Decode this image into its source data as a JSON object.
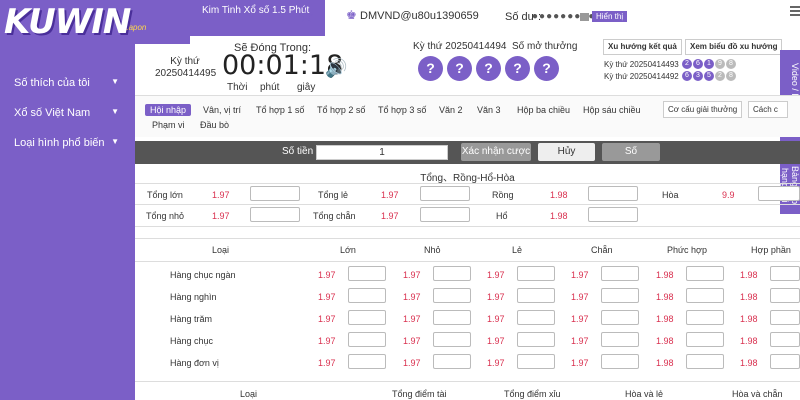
{
  "brand": {
    "logo": "KUWIN",
    "logo_sub": ".apon"
  },
  "sidebar": {
    "items": [
      {
        "label": "Số thích của tôi"
      },
      {
        "label": "Xổ số Việt Nam"
      },
      {
        "label": "Loại hình phổ biến"
      }
    ]
  },
  "header": {
    "game_title": "Kim Tinh Xổ số 1.5 Phút",
    "user": "DMVND@u80u1390659",
    "balance_label": "Số dư :",
    "balance_masked": "●●●●●●●●●●",
    "show_label": "Hiển thị"
  },
  "draw": {
    "period_label": "Kỳ thứ",
    "period": "20250414495",
    "close_label": "Sẽ Đóng Trong:",
    "timer": "00:01:18",
    "unit_h": "Thời",
    "unit_m": "phút",
    "unit_s": "giây",
    "open_period_label": "Kỳ thứ 20250414494",
    "open_label": "Số mở thưởng",
    "balls": [
      "?",
      "?",
      "?",
      "?",
      "?"
    ]
  },
  "trend": {
    "trend_btn": "Xu hướng kết quả",
    "chart_btn": "Xem biểu đồ xu hướng",
    "prev": [
      {
        "label": "Kỳ thứ 20250414493",
        "nums": [
          "2",
          "6",
          "1",
          "9",
          "8"
        ]
      },
      {
        "label": "Kỳ thứ 20250414492",
        "nums": [
          "6",
          "3",
          "5",
          "2",
          "8"
        ]
      }
    ]
  },
  "right_tabs": {
    "video": "Video / Bảng điểm",
    "table": "Bảng xếp hạng dài"
  },
  "tabs": [
    {
      "label": "Hội nhập"
    },
    {
      "label": "Vân, vị trí"
    },
    {
      "label": "Tổ hợp 1 số"
    },
    {
      "label": "Tổ hợp 2 số"
    },
    {
      "label": "Tổ hợp 3 số"
    },
    {
      "label": "Văn 2"
    },
    {
      "label": "Văn 3"
    },
    {
      "label": "Hộp ba chiều"
    },
    {
      "label": "Hộp sáu chiều"
    },
    {
      "label": "Phạm vi"
    },
    {
      "label": "Đầu bò"
    }
  ],
  "tab_buttons": {
    "prize": "Cơ cấu giải thưởng",
    "how": "Cách c"
  },
  "stake": {
    "label": "Số tiền",
    "value": "1",
    "confirm": "Xác nhận cược",
    "cancel": "Hủy",
    "number": "Số"
  },
  "section1": {
    "title": "Tổng、Rồng-Hổ-Hòa",
    "rows": [
      [
        {
          "l": "Tổng lớn",
          "o": "1.97"
        },
        {
          "l": "Tổng lẻ",
          "o": "1.97"
        },
        {
          "l": "Rồng",
          "o": "1.98"
        },
        {
          "l": "Hòa",
          "o": "9.9"
        }
      ],
      [
        {
          "l": "Tổng nhỏ",
          "o": "1.97"
        },
        {
          "l": "Tổng chẵn",
          "o": "1.97"
        },
        {
          "l": "Hổ",
          "o": "1.98"
        }
      ]
    ]
  },
  "section2": {
    "headers": [
      "Loại",
      "Lớn",
      "Nhỏ",
      "Lẻ",
      "Chẵn",
      "Phức hợp",
      "Hợp phần"
    ],
    "rows": [
      {
        "name": "Hàng chục ngàn",
        "odds": [
          "1.97",
          "1.97",
          "1.97",
          "1.97",
          "1.98",
          "1.98"
        ]
      },
      {
        "name": "Hàng nghìn",
        "odds": [
          "1.97",
          "1.97",
          "1.97",
          "1.97",
          "1.98",
          "1.98"
        ]
      },
      {
        "name": "Hàng trăm",
        "odds": [
          "1.97",
          "1.97",
          "1.97",
          "1.97",
          "1.98",
          "1.98"
        ]
      },
      {
        "name": "Hàng chục",
        "odds": [
          "1.97",
          "1.97",
          "1.97",
          "1.97",
          "1.98",
          "1.98"
        ]
      },
      {
        "name": "Hàng đơn vị",
        "odds": [
          "1.97",
          "1.97",
          "1.97",
          "1.97",
          "1.98",
          "1.98"
        ]
      }
    ]
  },
  "section3": {
    "headers": [
      "Loại",
      "Tổng điểm tài",
      "Tổng điểm xỉu",
      "Hòa và lẻ",
      "Hòa và chẵn"
    ]
  },
  "colors": {
    "accent": "#7b5fc7",
    "odd": "#d9304f",
    "bar": "#555555"
  }
}
